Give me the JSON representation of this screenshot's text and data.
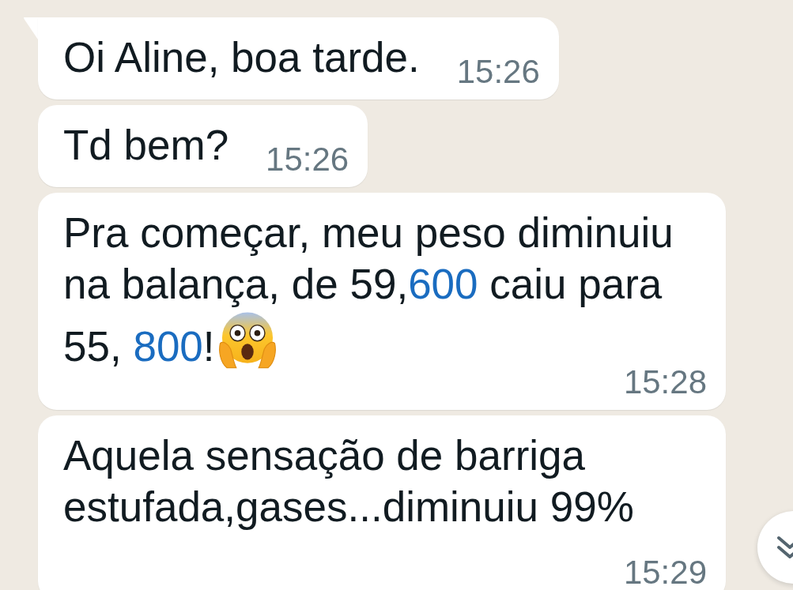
{
  "messages": [
    {
      "tail": true,
      "segments": [
        {
          "kind": "text",
          "text": "Oi Aline, boa tarde."
        }
      ],
      "time": "15:26"
    },
    {
      "tail": false,
      "segments": [
        {
          "kind": "text",
          "text": "Td bem?"
        }
      ],
      "time": "15:26"
    },
    {
      "tail": false,
      "segments": [
        {
          "kind": "text",
          "text": "Pra começar, meu peso diminuiu na balança, de 59,"
        },
        {
          "kind": "link",
          "text": "600"
        },
        {
          "kind": "text",
          "text": " caiu para 55, "
        },
        {
          "kind": "link",
          "text": "800"
        },
        {
          "kind": "text",
          "text": "!"
        },
        {
          "kind": "emoji"
        }
      ],
      "time": "15:28"
    },
    {
      "tail": false,
      "segments": [
        {
          "kind": "text",
          "text": "Aquela sensação de barriga estufada,gases...diminuiu 99%"
        }
      ],
      "time": "15:29"
    }
  ]
}
